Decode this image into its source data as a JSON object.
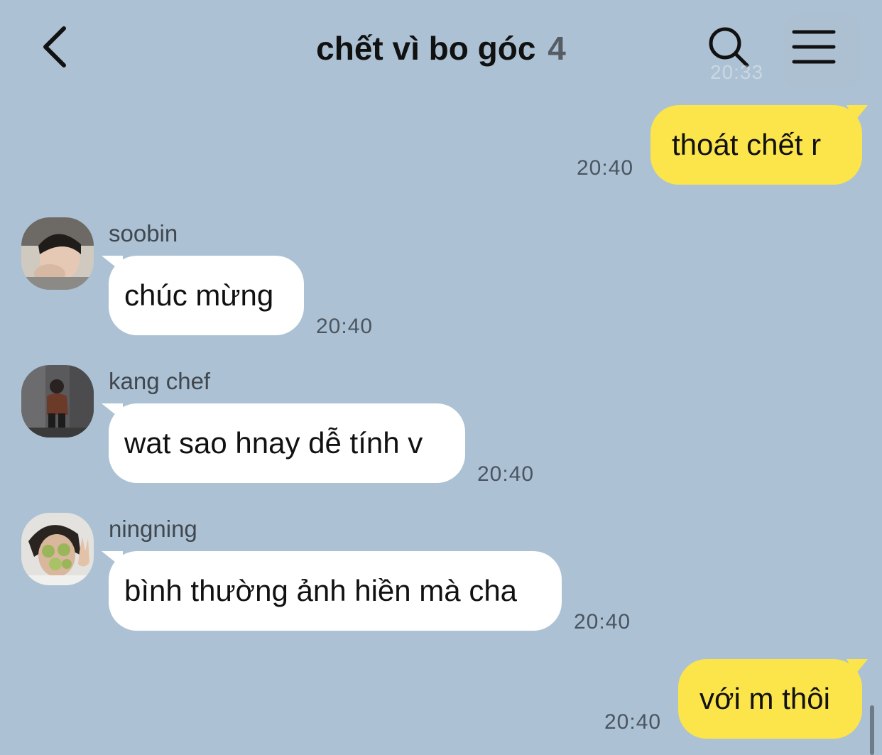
{
  "header": {
    "title": "chết vì bo góc",
    "member_count": "4",
    "back_icon": "chevron-left-icon",
    "search_icon": "search-icon",
    "menu_icon": "hamburger-menu-icon",
    "faded_time": "20:33"
  },
  "messages": [
    {
      "from": "me",
      "text": "thoát chết r",
      "time": "20:40"
    },
    {
      "from": "soobin",
      "sender": "soobin",
      "text": "chúc mừng",
      "time": "20:40"
    },
    {
      "from": "kang chef",
      "sender": "kang chef",
      "text": "wat sao hnay dễ tính v",
      "time": "20:40"
    },
    {
      "from": "ningning",
      "sender": "ningning",
      "text": "bình thường ảnh hiền mà cha",
      "time": "20:40"
    },
    {
      "from": "me",
      "text": "với m thôi",
      "time": "20:40"
    }
  ],
  "colors": {
    "background": "#acc2d4",
    "my_bubble": "#fbe54b",
    "their_bubble": "#ffffff"
  }
}
